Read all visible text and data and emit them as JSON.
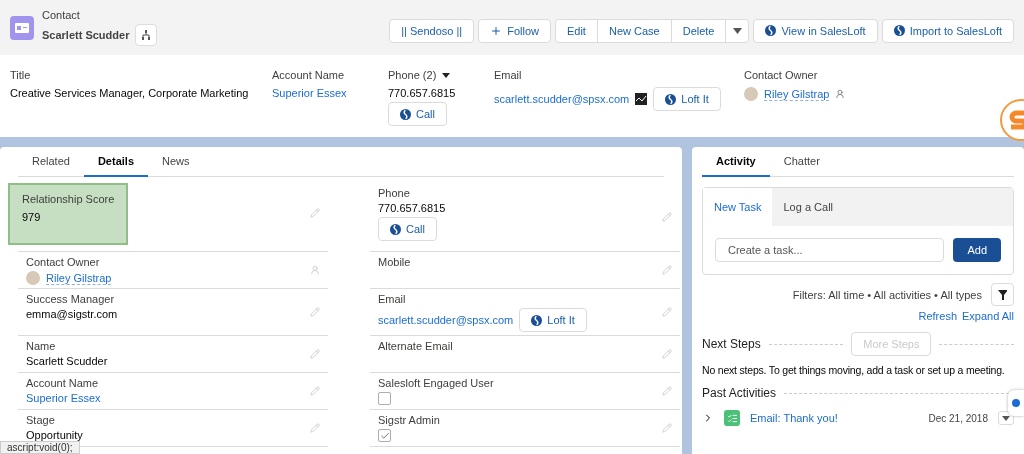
{
  "header": {
    "object_label": "Contact",
    "name": "Scarlett Scudder",
    "actions": [
      {
        "kind": "plain",
        "label": "|| Sendoso ||"
      },
      {
        "kind": "follow",
        "label": "Follow"
      },
      {
        "kind": "group",
        "items": [
          "Edit",
          "New Case",
          "Delete"
        ]
      },
      {
        "kind": "salesloft",
        "label": "View in SalesLoft"
      },
      {
        "kind": "salesloft",
        "label": "Import to SalesLoft"
      }
    ]
  },
  "highlights": [
    {
      "kind": "text",
      "label": "Title",
      "value": "Creative Services Manager, Corporate Marketing"
    },
    {
      "kind": "link",
      "label": "Account Name",
      "value": "Superior Essex"
    },
    {
      "kind": "phone",
      "label": "Phone (2)",
      "value": "770.657.6815",
      "button": "Call"
    },
    {
      "kind": "email",
      "label": "Email",
      "value": "scarlett.scudder@spsx.com",
      "button": "Loft It"
    },
    {
      "kind": "owner",
      "label": "Contact Owner",
      "value": "Riley Gilstrap"
    }
  ],
  "detail_tabs": [
    {
      "label": "Related",
      "selected": false
    },
    {
      "label": "Details",
      "selected": true
    },
    {
      "label": "News",
      "selected": false
    }
  ],
  "fields": [
    {
      "kind": "text",
      "label": "Relationship Score",
      "value": "979",
      "highlighted": true
    },
    {
      "kind": "phone",
      "label": "Phone",
      "value": "770.657.6815",
      "button": "Call",
      "highlighted": false
    },
    {
      "kind": "owner",
      "label": "Contact Owner",
      "value": "Riley Gilstrap",
      "highlighted": false
    },
    {
      "kind": "text",
      "label": "Mobile",
      "highlighted": false
    },
    {
      "kind": "text",
      "label": "Success Manager",
      "value": "emma@sigstr.com",
      "highlighted": false
    },
    {
      "kind": "email",
      "label": "Email",
      "value": "scarlett.scudder@spsx.com",
      "button": "Loft It",
      "highlighted": false
    },
    {
      "kind": "text",
      "label": "Name",
      "value": "Scarlett Scudder",
      "highlighted": false
    },
    {
      "kind": "text",
      "label": "Alternate Email",
      "highlighted": false
    },
    {
      "kind": "link",
      "label": "Account Name",
      "value": "Superior Essex",
      "highlighted": false
    },
    {
      "kind": "checkbox",
      "label": "Salesloft Engaged User",
      "checked": false,
      "highlighted": false
    },
    {
      "kind": "text",
      "label": "Stage",
      "value": "Opportunity",
      "highlighted": false
    },
    {
      "kind": "checkbox",
      "label": "Sigstr Admin",
      "checked": true,
      "highlighted": false
    }
  ],
  "activity_tabs": [
    {
      "label": "Activity",
      "selected": true
    },
    {
      "label": "Chatter",
      "selected": false
    }
  ],
  "composer": {
    "tabs": [
      {
        "label": "New Task",
        "selected": true
      },
      {
        "label": "Log a Call",
        "selected": false
      }
    ],
    "placeholder": "Create a task...",
    "button": "Add"
  },
  "filters": "Filters: All time • All activities • All types",
  "links": [
    "Refresh",
    "Expand All"
  ],
  "next_steps": {
    "title": "Next Steps",
    "button": "More Steps",
    "button_disabled": true,
    "empty": "No next steps. To get things moving, add a task or set up a meeting."
  },
  "past": {
    "title": "Past Activities",
    "items": [
      {
        "title": "Email: Thank you!",
        "date": "Dec 21, 2018"
      }
    ]
  },
  "status_tooltip": "ascript:void(0);"
}
